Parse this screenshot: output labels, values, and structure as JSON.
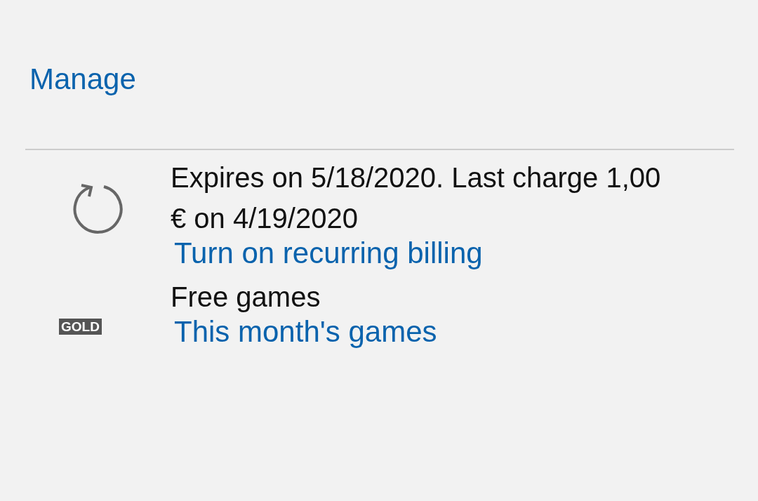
{
  "manage_link": "Manage",
  "items": [
    {
      "kind": "renewal",
      "text": "Expires on 5/18/2020. Last charge 1,00 € on 4/19/2020",
      "link": "Turn on recurring billing"
    },
    {
      "kind": "gold",
      "badge": "GOLD",
      "text": "Free games",
      "link": "This month's games"
    }
  ]
}
